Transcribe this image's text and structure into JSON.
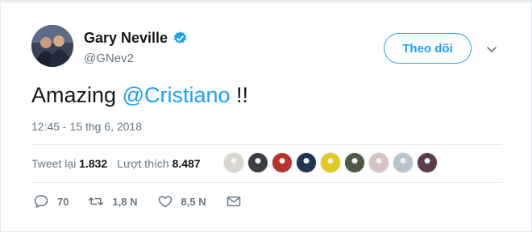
{
  "author": {
    "name": "Gary Neville",
    "handle": "@GNev2",
    "verified": true,
    "avatar_icon": "profile-photo"
  },
  "follow_button": {
    "label": "Theo dõi"
  },
  "menu": {
    "icon": "chevron-down-icon"
  },
  "tweet": {
    "text_before": "Amazing ",
    "mention": "@Cristiano",
    "text_after": " !!",
    "timestamp": "12:45 - 15 thg 6, 2018"
  },
  "stats": {
    "retweets_label": "Tweet lại",
    "retweets_value": "1.832",
    "likes_label": "Lượt thích",
    "likes_value": "8.487"
  },
  "likers": [
    {
      "color": "#d9d6cf"
    },
    {
      "color": "#3b3f45"
    },
    {
      "color": "#b8322e"
    },
    {
      "color": "#1f3550"
    },
    {
      "color": "#e2c91e"
    },
    {
      "color": "#4d5a48"
    },
    {
      "color": "#d8c1c0"
    },
    {
      "color": "#b9c3cc"
    },
    {
      "color": "#5c3b4a"
    }
  ],
  "actions": {
    "reply_count": "70",
    "retweet_count": "1,8 N",
    "like_count": "8,5 N"
  },
  "colors": {
    "accent": "#1da1f2",
    "muted": "#657786",
    "text": "#14171a"
  }
}
